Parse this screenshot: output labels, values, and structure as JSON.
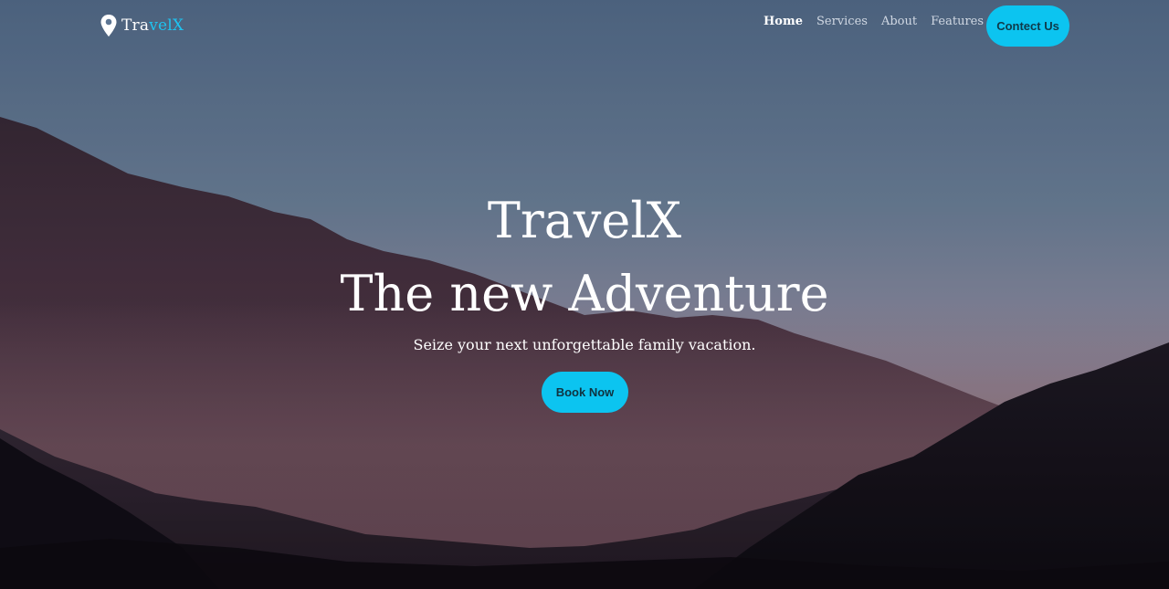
{
  "brand": {
    "name_part1": "Tra",
    "name_part2": "velX",
    "icon": "map-pin-icon",
    "accent_color": "#1ec3f0"
  },
  "nav": {
    "links": [
      {
        "label": "Home",
        "active": true
      },
      {
        "label": "Services",
        "active": false
      },
      {
        "label": "About",
        "active": false
      },
      {
        "label": "Features",
        "active": false
      }
    ],
    "cta_label": "Contect Us"
  },
  "hero": {
    "title": "TravelX",
    "subtitle": "The new Adventure",
    "description": "Seize your next unforgettable family vacation.",
    "cta_label": "Book Now",
    "background": "mountain-range-at-dusk"
  },
  "colors": {
    "button": "#0cc4f0",
    "sky_top": "#5a7494",
    "sky_horizon": "#a9909a",
    "mountain_dark": "#1a1420"
  }
}
